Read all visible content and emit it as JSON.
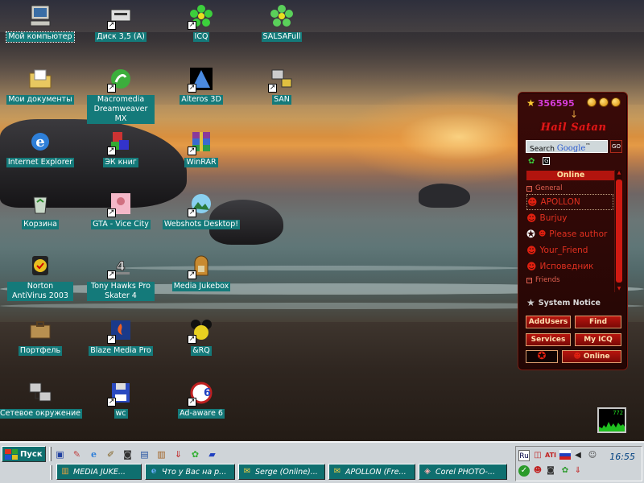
{
  "desktop_icons": [
    {
      "label": "Мой компьютер",
      "icon": "my-computer-icon",
      "shortcut": false
    },
    {
      "label": "Диск 3,5 (A)",
      "icon": "floppy-drive-icon",
      "shortcut": true
    },
    {
      "label": "ICQ",
      "icon": "icq-flower-icon",
      "shortcut": true
    },
    {
      "label": "SALSAFull",
      "icon": "salsa-flower-icon",
      "shortcut": false
    },
    {
      "label": "Мои документы",
      "icon": "my-documents-folder-icon",
      "shortcut": false
    },
    {
      "label": "Macromedia Dreamweaver MX",
      "icon": "dreamweaver-icon",
      "shortcut": true
    },
    {
      "label": "Alteros 3D",
      "icon": "alteros-3d-icon",
      "shortcut": true
    },
    {
      "label": "SAN",
      "icon": "san-network-icon",
      "shortcut": true
    },
    {
      "label": "Internet Explorer",
      "icon": "internet-explorer-icon",
      "shortcut": false
    },
    {
      "label": "ЭК книг",
      "icon": "abc-blocks-icon",
      "shortcut": true
    },
    {
      "label": "WinRAR",
      "icon": "winrar-icon",
      "shortcut": true
    },
    {
      "label": "Корзина",
      "icon": "recycle-bin-icon",
      "shortcut": false
    },
    {
      "label": "GTA - Vice City",
      "icon": "gta-vice-city-icon",
      "shortcut": true
    },
    {
      "label": "Webshots Desktop!",
      "icon": "webshots-icon",
      "shortcut": true
    },
    {
      "label": "Norton AntiVirus 2003",
      "icon": "norton-antivirus-icon",
      "shortcut": false
    },
    {
      "label": "Tony Hawks Pro Skater 4",
      "icon": "tony-hawk-icon",
      "shortcut": true
    },
    {
      "label": "Media Jukebox",
      "icon": "jukebox-icon",
      "shortcut": true
    },
    {
      "label": "Портфель",
      "icon": "briefcase-icon",
      "shortcut": false
    },
    {
      "label": "Blaze Media Pro",
      "icon": "blaze-media-icon",
      "shortcut": true
    },
    {
      "label": "&RQ",
      "icon": "andrq-icon",
      "shortcut": true
    },
    {
      "label": "Сетевое окружение",
      "icon": "network-neighborhood-icon",
      "shortcut": false
    },
    {
      "label": "wc",
      "icon": "wc-disk-icon",
      "shortcut": true
    },
    {
      "label": "Ad-aware 6",
      "icon": "ad-aware-icon",
      "shortcut": true
    }
  ],
  "icq": {
    "uin": "356595",
    "title": "Hail Satan",
    "search_prefix": "Search",
    "search_brand": "Google",
    "search_tm": "™",
    "go_label": "GO",
    "online_header": "Online",
    "groups": [
      {
        "name": "General",
        "contacts": [
          "APOLLON",
          "Burjuy",
          "Please author",
          "Your_Friend",
          "Исповедник"
        ]
      },
      {
        "name": "Friends",
        "contacts": []
      }
    ],
    "system_notice": "System Notice",
    "buttons": {
      "add_users": "AddUsers",
      "find": "Find",
      "services": "Services",
      "my_icq": "My ICQ",
      "status": "Online"
    }
  },
  "cpu_monitor": {
    "value": "772"
  },
  "taskbar": {
    "start_label": "Пуск",
    "quick_launch": [
      "save-disk-icon",
      "paint-icon",
      "ie-icon",
      "edit-icon",
      "camera-icon",
      "network-icon",
      "jukebox-icon",
      "download-icon",
      "icq-icon",
      "book-icon"
    ],
    "tasks": [
      {
        "label": "MEDIA JUKE...",
        "icon": "jukebox-icon"
      },
      {
        "label": "Что у Вас на р...",
        "icon": "ie-icon"
      },
      {
        "label": "Serge (Online)...",
        "icon": "message-icon"
      },
      {
        "label": "APOLLON (Fre...",
        "icon": "message-icon"
      },
      {
        "label": "Corel PHOTO-...",
        "icon": "corel-icon"
      }
    ],
    "tray": {
      "lang": "Ru",
      "clock": "16:55"
    }
  },
  "colors": {
    "label_bg": "#147a7a",
    "icq_red": "#e01818",
    "taskbar": "#cfd4d8",
    "task_button": "#0f6f6f"
  }
}
